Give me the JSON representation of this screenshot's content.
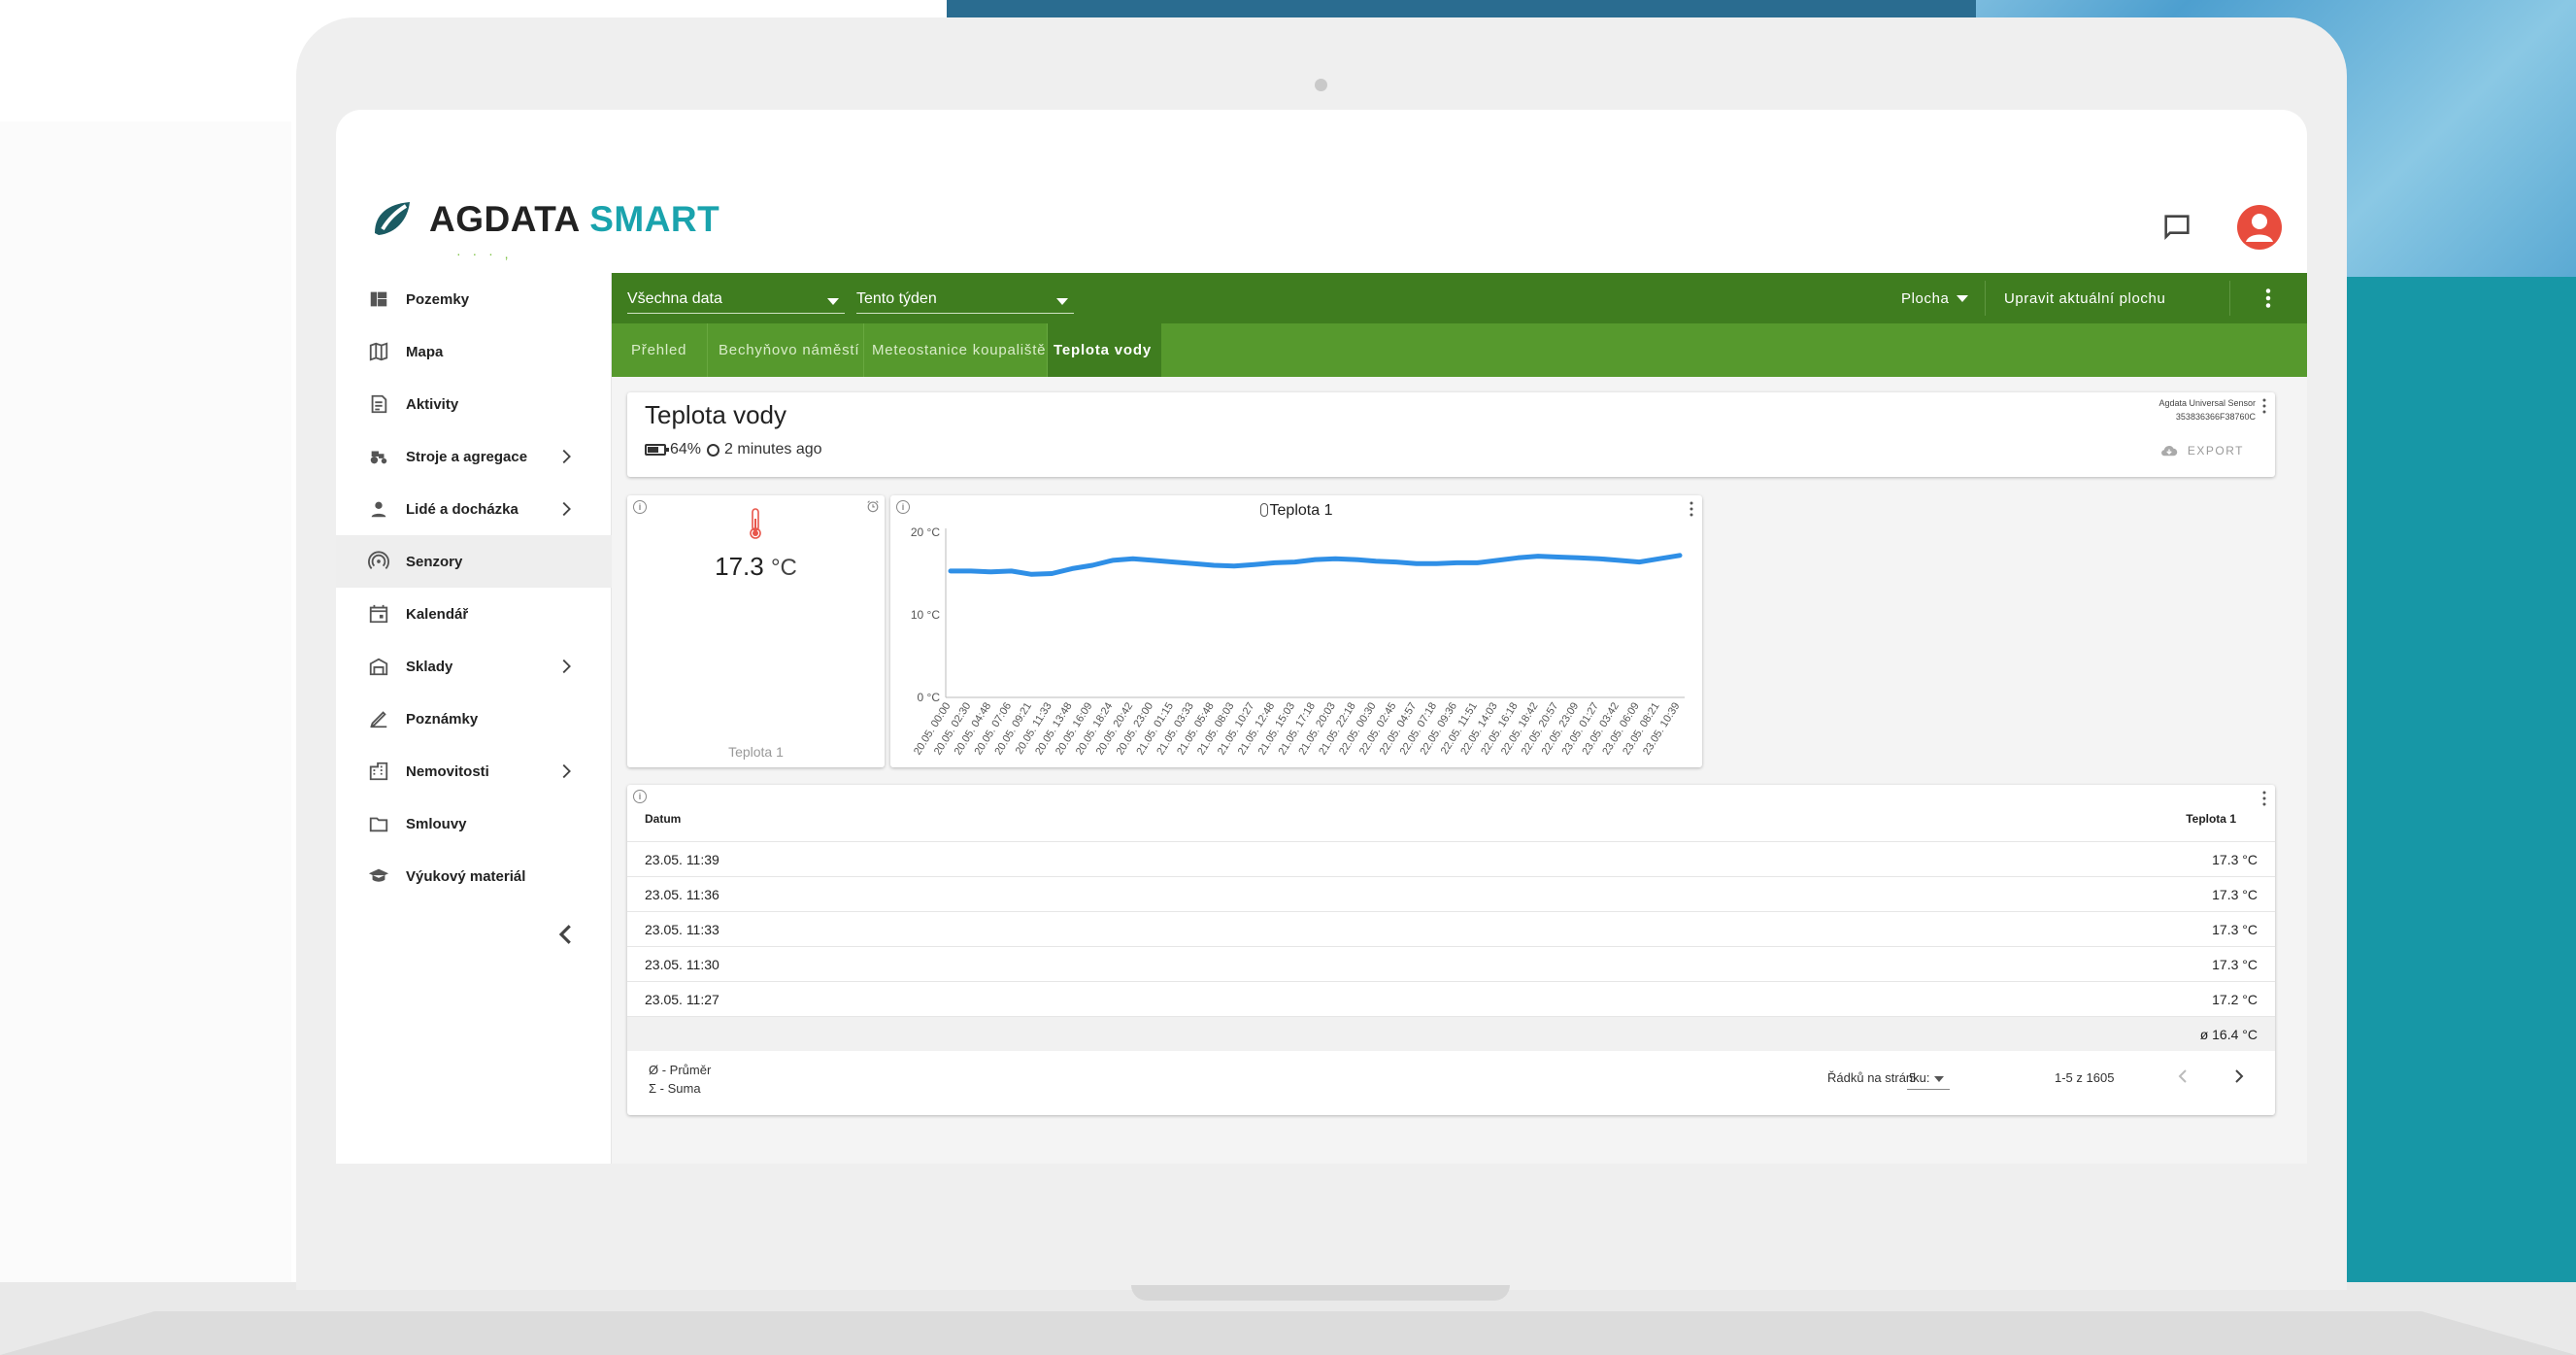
{
  "brand": {
    "name_part1": "AGDATA",
    "name_part2": "SMART",
    "accent": "#1aa3ad"
  },
  "header": {
    "chat_icon": "chat-icon",
    "user_icon": "account-icon"
  },
  "sidebar": {
    "items": [
      {
        "label": "Pozemky",
        "icon": "dashboard-icon",
        "has_children": false,
        "active": false
      },
      {
        "label": "Mapa",
        "icon": "map-icon",
        "has_children": false,
        "active": false
      },
      {
        "label": "Aktivity",
        "icon": "activity-icon",
        "has_children": false,
        "active": false
      },
      {
        "label": "Stroje a agregace",
        "icon": "tractor-icon",
        "has_children": true,
        "active": false
      },
      {
        "label": "Lidé a docházka",
        "icon": "person-icon",
        "has_children": true,
        "active": false
      },
      {
        "label": "Senzory",
        "icon": "sensor-icon",
        "has_children": false,
        "active": true
      },
      {
        "label": "Kalendář",
        "icon": "calendar-icon",
        "has_children": false,
        "active": false
      },
      {
        "label": "Sklady",
        "icon": "warehouse-icon",
        "has_children": true,
        "active": false
      },
      {
        "label": "Poznámky",
        "icon": "pencil-icon",
        "has_children": false,
        "active": false
      },
      {
        "label": "Nemovitosti",
        "icon": "building-icon",
        "has_children": true,
        "active": false
      },
      {
        "label": "Smlouvy",
        "icon": "folder-icon",
        "has_children": false,
        "active": false
      },
      {
        "label": "Výukový materiál",
        "icon": "school-icon",
        "has_children": false,
        "active": false
      }
    ]
  },
  "toolbar": {
    "data_filter": "Všechna data",
    "period_filter": "Tento týden",
    "dashboard_menu": "Plocha",
    "edit_button": "Upravit aktuální plochu",
    "primary_color": "#3f7d1f"
  },
  "tabs": [
    {
      "label": "Přehled",
      "active": false
    },
    {
      "label": "Bechyňovo náměstí",
      "active": false
    },
    {
      "label": "Meteostanice koupaliště",
      "active": false
    },
    {
      "label": "Teplota vody",
      "active": true
    }
  ],
  "sensor": {
    "title": "Teplota vody",
    "battery": "64%",
    "last_update": "2 minutes ago",
    "device_name": "Agdata Universal Sensor",
    "device_id": "353836366F38760C",
    "export_label": "EXPORT"
  },
  "value_widget": {
    "value": "17.3",
    "unit": "°C",
    "caption": "Teplota 1"
  },
  "chart_data": {
    "type": "line",
    "title": "Teplota 1",
    "ylabel": "",
    "ylim": [
      0,
      20
    ],
    "yticks": [
      "0 °C",
      "10 °C",
      "20 °C"
    ],
    "x": [
      "20.05. 00:00",
      "20.05. 02:30",
      "20.05. 04:48",
      "20.05. 07:06",
      "20.05. 09:21",
      "20.05. 11:33",
      "20.05. 13:48",
      "20.05. 16:09",
      "20.05. 18:24",
      "20.05. 20:42",
      "20.05. 23:00",
      "21.05. 01:15",
      "21.05. 03:33",
      "21.05. 05:48",
      "21.05. 08:03",
      "21.05. 10:27",
      "21.05. 12:48",
      "21.05. 15:03",
      "21.05. 17:18",
      "21.05. 20:03",
      "21.05. 22:18",
      "22.05. 00:30",
      "22.05. 02:45",
      "22.05. 04:57",
      "22.05. 07:18",
      "22.05. 09:36",
      "22.05. 11:51",
      "22.05. 14:03",
      "22.05. 16:18",
      "22.05. 18:42",
      "22.05. 20:57",
      "22.05. 23:09",
      "23.05. 01:27",
      "23.05. 03:42",
      "23.05. 06:09",
      "23.05. 08:21",
      "23.05. 10:39"
    ],
    "series": [
      {
        "values": [
          15.3,
          15.3,
          15.2,
          15.3,
          14.9,
          15.0,
          15.6,
          16.0,
          16.6,
          16.8,
          16.6,
          16.4,
          16.2,
          16.0,
          15.9,
          16.1,
          16.3,
          16.4,
          16.7,
          16.8,
          16.7,
          16.5,
          16.4,
          16.2,
          16.2,
          16.3,
          16.3,
          16.6,
          16.9,
          17.1,
          17.0,
          16.9,
          16.8,
          16.6,
          16.4,
          16.8,
          17.2
        ],
        "color": "#2f8fe6"
      }
    ]
  },
  "table": {
    "headers": [
      "Datum",
      "Teplota 1"
    ],
    "rows": [
      [
        "23.05. 11:39",
        "17.3 °C"
      ],
      [
        "23.05. 11:36",
        "17.3 °C"
      ],
      [
        "23.05. 11:33",
        "17.3 °C"
      ],
      [
        "23.05. 11:30",
        "17.3 °C"
      ],
      [
        "23.05. 11:27",
        "17.2 °C"
      ]
    ],
    "average": "ø 16.4 °C",
    "legend_avg": "Ø - Průměr",
    "legend_sum": "Σ - Suma",
    "rows_per_page_label": "Řádků na stránku:",
    "rows_per_page": "5",
    "range": "1-5 z 1605"
  }
}
